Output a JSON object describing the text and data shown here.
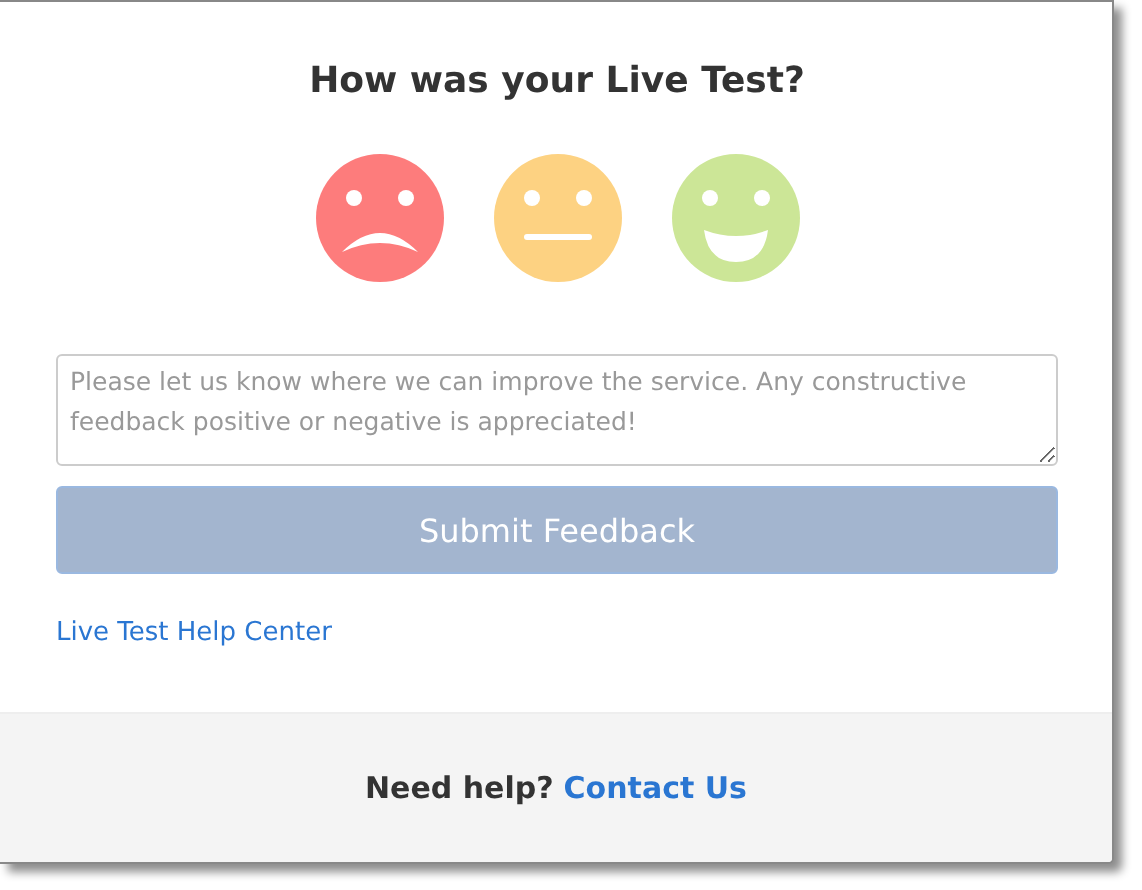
{
  "title": "How was your Live Test?",
  "ratings": [
    {
      "kind": "sad",
      "color": "#fd7c7c"
    },
    {
      "kind": "neutral",
      "color": "#fdd282"
    },
    {
      "kind": "happy",
      "color": "#cce697"
    }
  ],
  "feedback": {
    "placeholder": "Please let us know where we can improve the service. Any constructive feedback positive or negative is appreciated!"
  },
  "submit_button": {
    "label": "Submit Feedback",
    "disabled": true
  },
  "help_link": "Live Test Help Center",
  "footer": {
    "text": "Need help?",
    "link": "Contact Us"
  }
}
